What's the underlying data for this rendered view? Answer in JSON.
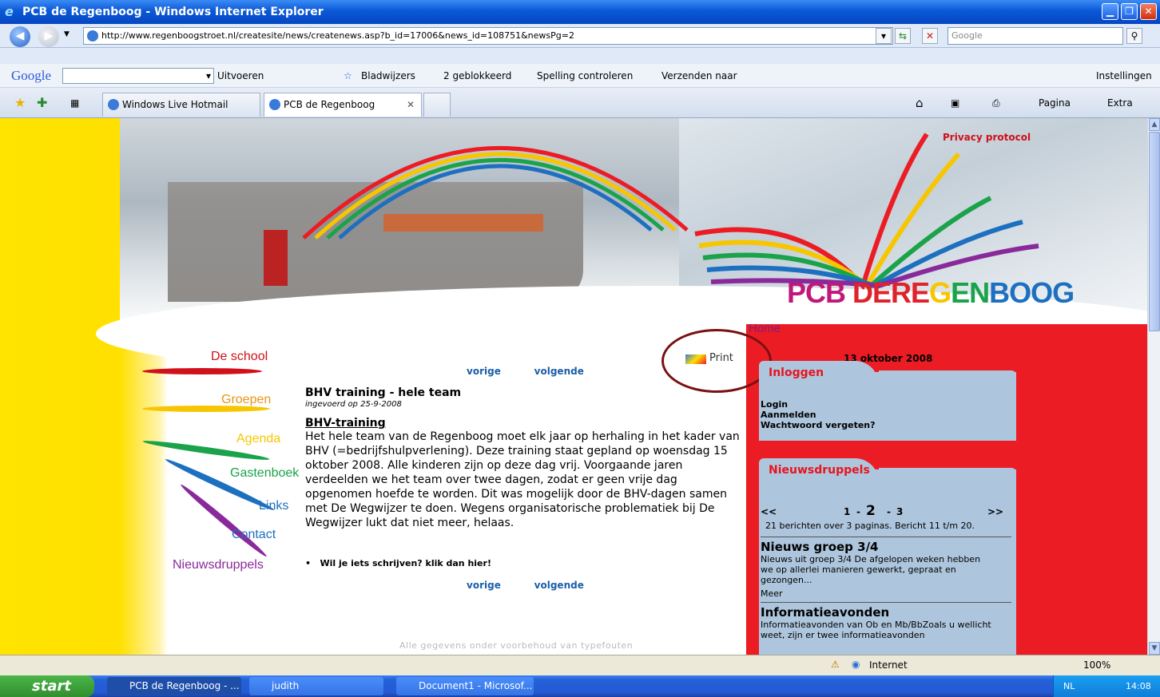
{
  "window": {
    "title": "PCB de Regenboog - Windows Internet Explorer"
  },
  "address": {
    "url": "http://www.regenboogstroet.nl/createsite/news/createnews.asp?b_id=17006&news_id=108751&newsPg=2",
    "search_placeholder": "Google"
  },
  "googlebar": {
    "brand": "Google",
    "run": "Uitvoeren",
    "bookmarks": "Bladwijzers",
    "blocked": "2 geblokkeerd",
    "spell": "Spelling controleren",
    "send": "Verzenden naar",
    "settings": "Instellingen"
  },
  "tabs": [
    {
      "label": "Windows Live Hotmail"
    },
    {
      "label": "PCB de Regenboog"
    }
  ],
  "commandbar": {
    "page": "Pagina",
    "extra": "Extra"
  },
  "site": {
    "privacy": "Privacy protocol",
    "logo_pcb": "PCB",
    "logo_de": "DE",
    "logo_re": "RE",
    "logo_g": "G",
    "logo_en": "EN",
    "logo_boog": "BOOG",
    "home": "Home",
    "nav": [
      "De school",
      "Groepen",
      "Agenda",
      "Gastenboek",
      "Links",
      "Contact",
      "Nieuwsdruppels"
    ],
    "print": "Print",
    "prev": "vorige",
    "next": "volgende",
    "article": {
      "title": "BHV training - hele team",
      "entered": "ingevoerd op 25-9-2008",
      "heading": "BHV-training",
      "body": "Het hele team van de Regenboog moet elk jaar op herhaling in het kader van BHV (=bedrijfshulpverlening). Deze training staat gepland op woensdag 15 oktober 2008. Alle kinderen zijn op deze dag vrij. Voorgaande jaren verdeelden we het team over twee dagen, zodat er geen vrije dag opgenomen hoefde te worden. Dit was mogelijk door de BHV-dagen samen met De Wegwijzer te doen. Wegens organisatorische problematiek bij De Wegwijzer lukt dat niet meer, helaas."
    },
    "write_link": "Wil je iets schrijven? klik dan hier!",
    "footer": "Alle gegevens onder voorbehoud van typefouten",
    "date": "13 oktober 2008",
    "login": {
      "title": "Inloggen",
      "items": [
        "Login",
        "Aanmelden",
        "Wachtwoord vergeten?"
      ]
    },
    "news": {
      "title": "Nieuwsdruppels",
      "first": "<<",
      "last": ">>",
      "pages": [
        "1",
        "2",
        "3"
      ],
      "summary": "21 berichten over 3 paginas. Bericht 11 t/m 20.",
      "items": [
        {
          "title": "Nieuws groep 3/4",
          "text": "Nieuws uit groep 3/4 De afgelopen weken hebben we op allerlei manieren gewerkt, gepraat en gezongen...",
          "more": "Meer"
        },
        {
          "title": "Informatieavonden",
          "text": "Informatieavonden van Ob en Mb/BbZoals u wellicht weet, zijn er twee informatieavonden"
        }
      ]
    }
  },
  "status": {
    "zone": "Internet",
    "zoom": "100%"
  },
  "taskbar": {
    "start": "start",
    "tasks": [
      "PCB de Regenboog - ...",
      "judith",
      "Document1 - Microsof..."
    ],
    "lang": "NL",
    "time": "14:08"
  }
}
